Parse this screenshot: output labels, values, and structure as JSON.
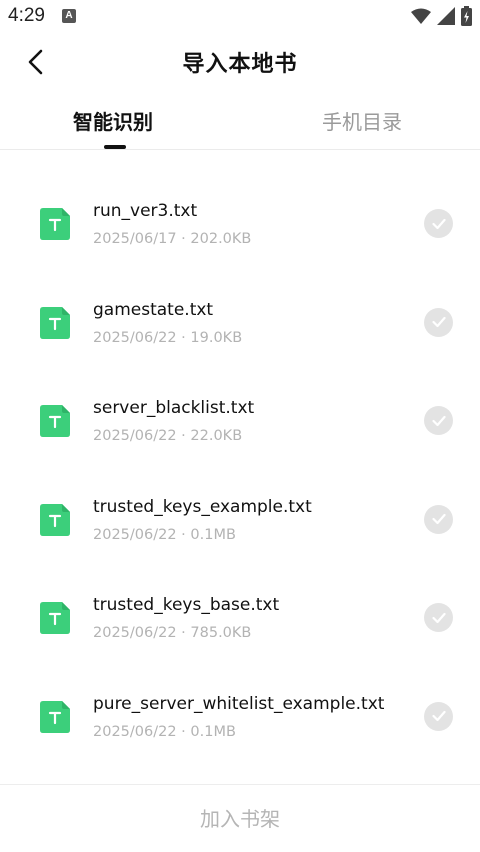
{
  "status_bar": {
    "time": "4:29",
    "notification_letter": "A"
  },
  "header": {
    "title": "导入本地书"
  },
  "tabs": [
    {
      "label": "智能识别",
      "active": true
    },
    {
      "label": "手机目录",
      "active": false
    }
  ],
  "files": [
    {
      "icon_letter": "T",
      "name": "run_ver3.txt",
      "meta": "2025/06/17 · 202.0KB"
    },
    {
      "icon_letter": "T",
      "name": "gamestate.txt",
      "meta": "2025/06/22 · 19.0KB"
    },
    {
      "icon_letter": "T",
      "name": "server_blacklist.txt",
      "meta": "2025/06/22 · 22.0KB"
    },
    {
      "icon_letter": "T",
      "name": "trusted_keys_example.txt",
      "meta": "2025/06/22 · 0.1MB"
    },
    {
      "icon_letter": "T",
      "name": "trusted_keys_base.txt",
      "meta": "2025/06/22 · 785.0KB"
    },
    {
      "icon_letter": "T",
      "name": "pure_server_whitelist_example.txt",
      "meta": "2025/06/22 · 0.1MB"
    }
  ],
  "bottom": {
    "add_label": "加入书架"
  },
  "colors": {
    "file_icon": "#3ccf7b",
    "check_bg": "#e3e3e3",
    "disabled_text": "#b5b5b5"
  }
}
